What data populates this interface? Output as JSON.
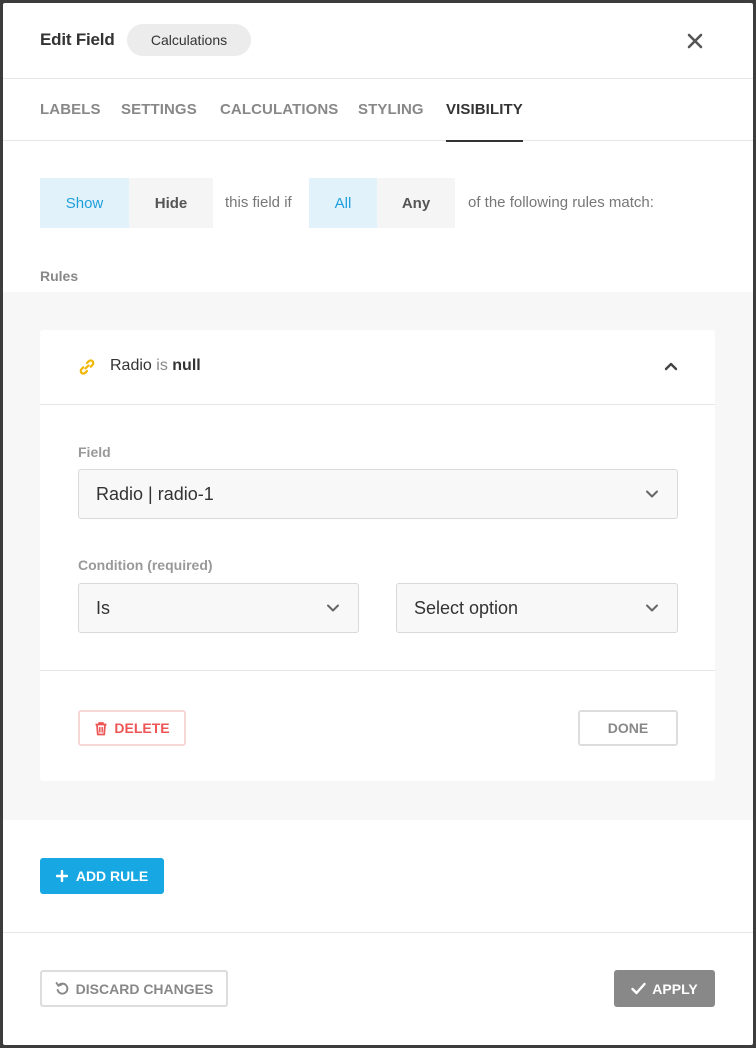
{
  "header": {
    "title": "Edit Field",
    "field_type_tag": "Calculations",
    "close_icon": "close-icon"
  },
  "tabs": [
    {
      "label": "LABELS",
      "active": false
    },
    {
      "label": "SETTINGS",
      "active": false
    },
    {
      "label": "CALCULATIONS",
      "active": false
    },
    {
      "label": "STYLING",
      "active": false
    },
    {
      "label": "VISIBILITY",
      "active": true
    }
  ],
  "visibility": {
    "action_options": [
      "Show",
      "Hide"
    ],
    "action_selected": "Show",
    "text_middle": "this field if",
    "match_options": [
      "All",
      "Any"
    ],
    "match_selected": "All",
    "text_end": "of the following rules match:"
  },
  "rules": {
    "label": "Rules",
    "items": [
      {
        "summary_field": "Radio",
        "summary_op": "is",
        "summary_value": "null",
        "field_label": "Field",
        "field_value": "Radio | radio-1",
        "condition_label": "Condition (required)",
        "condition_value": "Is",
        "option_placeholder": "Select option",
        "delete_label": "DELETE",
        "done_label": "DONE"
      }
    ],
    "add_rule_label": "ADD RULE"
  },
  "footer": {
    "discard_label": "DISCARD CHANGES",
    "apply_label": "APPLY"
  },
  "colors": {
    "accent": "#17a8e3",
    "selected_bg": "#e1f2fb",
    "danger": "#e55555",
    "apply_bg": "#888888",
    "link_icon": "#f2b705"
  }
}
